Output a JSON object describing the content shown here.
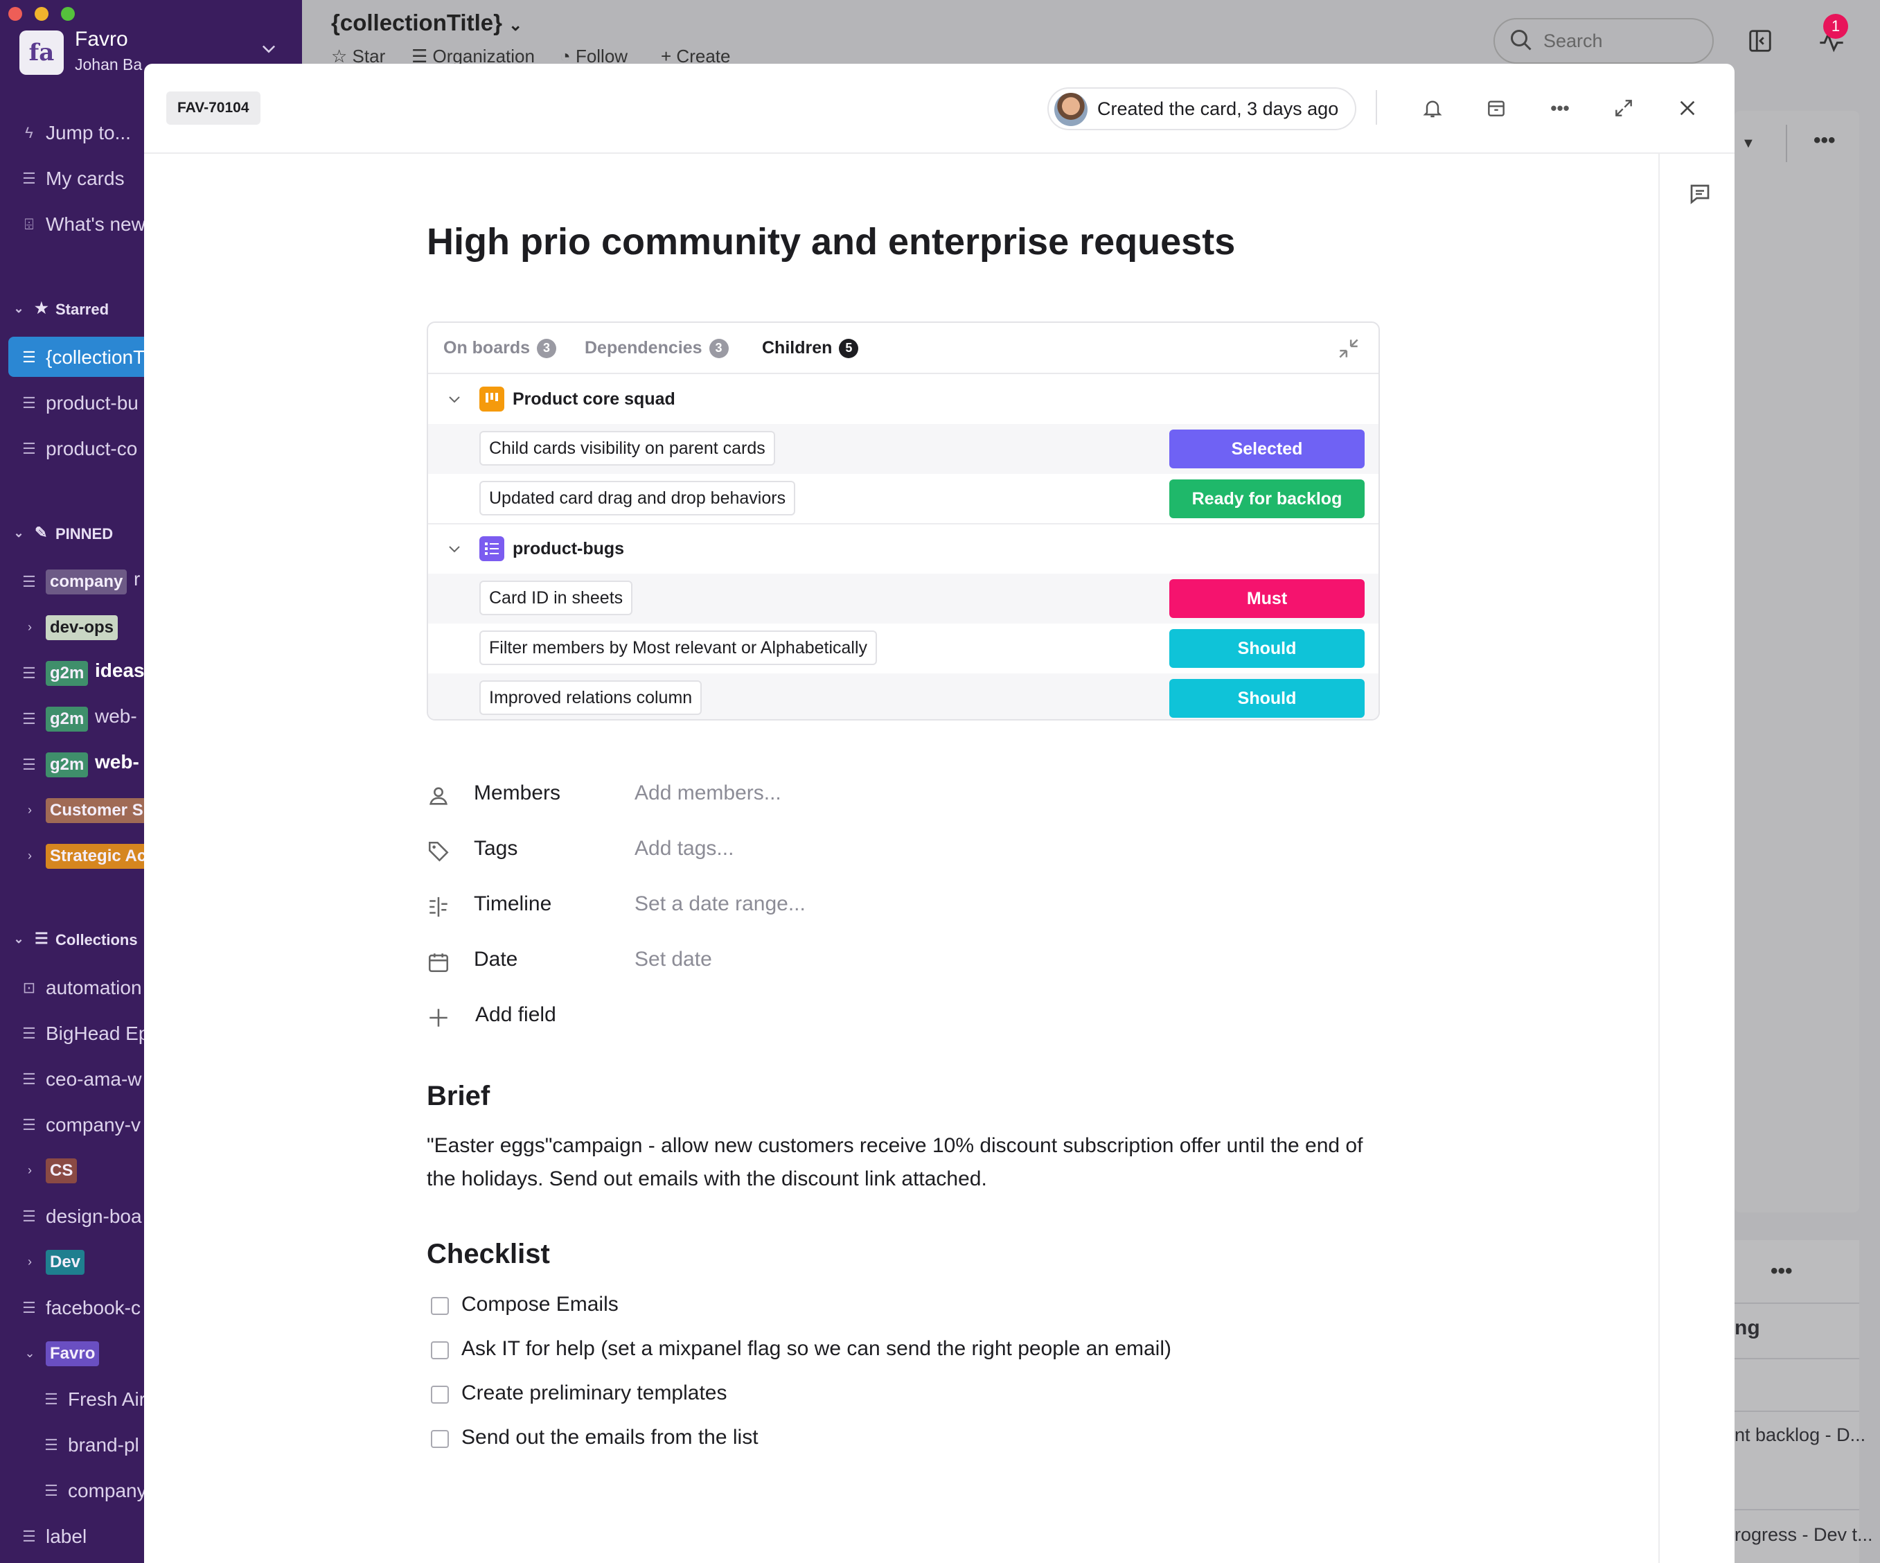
{
  "workspace": {
    "name": "Favro",
    "user": "Johan Ba"
  },
  "sidebar": {
    "nav": [
      {
        "label": "Jump to...",
        "icon": "bolt-icon"
      },
      {
        "label": "My cards",
        "icon": "cards-icon"
      },
      {
        "label": "What's new",
        "icon": "gift-icon"
      }
    ],
    "starred_header": "Starred",
    "starred": [
      "{collectionT",
      "product-bu",
      "product-co"
    ],
    "pinned_header": "PINNED",
    "pinned": [
      {
        "tag": "company",
        "rest": "r",
        "tag_color": "#6d5a86"
      },
      {
        "tag": "dev-ops",
        "rest": "",
        "tag_color": "#c9d6c4"
      },
      {
        "tag": "g2m",
        "rest": "ideas",
        "tag_color": "#3f8f6b"
      },
      {
        "tag": "g2m",
        "rest": "web-",
        "tag_color": "#3f8f6b"
      },
      {
        "tag": "g2m",
        "rest": "web-",
        "tag_color": "#3f8f6b"
      },
      {
        "tag": "Customer Su",
        "rest": "",
        "tag_color": "#a06a55"
      },
      {
        "tag": "Strategic Ac",
        "rest": "",
        "tag_color": "#d6861f"
      }
    ],
    "collections_header": "Collections",
    "collections": [
      {
        "label": "automation",
        "kind": "lock"
      },
      {
        "label": "BigHead Ep",
        "kind": "list"
      },
      {
        "label": "ceo-ama-w",
        "kind": "list"
      },
      {
        "label": "company-v",
        "kind": "list"
      },
      {
        "label": "CS",
        "kind": "tag",
        "tag_color": "#8a4a44"
      },
      {
        "label": "design-boa",
        "kind": "list"
      },
      {
        "label": "Dev",
        "kind": "tag",
        "tag_color": "#1f7f8f"
      },
      {
        "label": "facebook-c",
        "kind": "list"
      },
      {
        "label": "Favro",
        "kind": "tag",
        "tag_color": "#6a4fc2"
      },
      {
        "label": "Fresh Air",
        "kind": "sublist"
      },
      {
        "label": "brand-pl",
        "kind": "sublist"
      },
      {
        "label": "company",
        "kind": "sublist"
      },
      {
        "label": "label",
        "kind": "list"
      }
    ]
  },
  "topbar": {
    "collection_title": "{collectionTitle}",
    "actions": [
      "Star",
      "Organization",
      "Follow",
      "Create"
    ],
    "search_placeholder": "Search",
    "activity_count": "1"
  },
  "background": {
    "texts": [
      "ng",
      "nt backlog - D...",
      "rogress - Dev t..."
    ]
  },
  "card": {
    "id": "FAV-70104",
    "created": "Created the card, 3 days ago",
    "title": "High prio community and enterprise requests",
    "relations": {
      "tabs": [
        {
          "label": "On boards",
          "count": "3",
          "active": false
        },
        {
          "label": "Dependencies",
          "count": "3",
          "active": false
        },
        {
          "label": "Children",
          "count": "5",
          "active": true
        }
      ],
      "groups": [
        {
          "name": "Product core squad",
          "icon_color": "#f59a0c",
          "children": [
            {
              "title": "Child cards visibility on parent cards",
              "status": "Selected",
              "color": "#6f62f4"
            },
            {
              "title": "Updated card drag and drop behaviors",
              "status": "Ready for backlog",
              "color": "#1fb86a"
            }
          ]
        },
        {
          "name": "product-bugs",
          "icon_color": "#7b5cf0",
          "children": [
            {
              "title": "Card ID in sheets",
              "status": "Must",
              "color": "#f5136e"
            },
            {
              "title": "Filter members by Most relevant or Alphabetically",
              "status": "Should",
              "color": "#0fc3d8"
            },
            {
              "title": "Improved relations column",
              "status": "Should",
              "color": "#0fc3d8"
            }
          ]
        }
      ]
    },
    "fields": [
      {
        "label": "Members",
        "value": "Add members...",
        "icon": "member-icon"
      },
      {
        "label": "Tags",
        "value": "Add tags...",
        "icon": "tag-icon"
      },
      {
        "label": "Timeline",
        "value": "Set a date range...",
        "icon": "timeline-icon"
      },
      {
        "label": "Date",
        "value": "Set date",
        "icon": "calendar-icon"
      }
    ],
    "add_field": "Add field",
    "brief_heading": "Brief",
    "brief": "\"Easter eggs\"campaign - allow new customers receive 10% discount subscription offer until the end of the holidays. Send out emails with the discount link attached.",
    "checklist_heading": "Checklist",
    "checklist": [
      "Compose Emails",
      "Ask IT for help (set a mixpanel flag so we can send the right people an email)",
      "Create preliminary templates",
      "Send out the emails from the list"
    ]
  }
}
